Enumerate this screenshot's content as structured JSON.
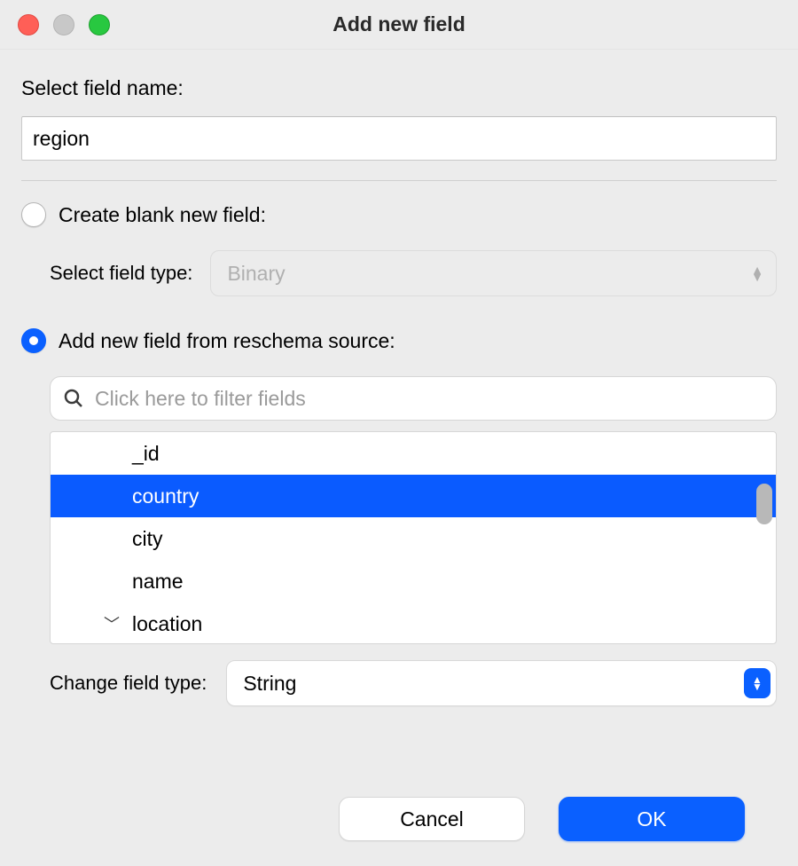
{
  "window": {
    "title": "Add new field"
  },
  "fieldName": {
    "label": "Select field name:",
    "value": "region"
  },
  "option_blank": {
    "label": "Create blank new field:",
    "selected": false,
    "type_label": "Select field type:",
    "type_value": "Binary"
  },
  "option_reschema": {
    "label": "Add new field from reschema source:",
    "selected": true,
    "filter_placeholder": "Click here to filter fields",
    "fields": [
      {
        "name": "_id",
        "selected": false,
        "expandable": false
      },
      {
        "name": "country",
        "selected": true,
        "expandable": false
      },
      {
        "name": "city",
        "selected": false,
        "expandable": false
      },
      {
        "name": "name",
        "selected": false,
        "expandable": false
      },
      {
        "name": "location",
        "selected": false,
        "expandable": true
      }
    ],
    "change_type_label": "Change field type:",
    "change_type_value": "String"
  },
  "footer": {
    "cancel": "Cancel",
    "ok": "OK"
  }
}
